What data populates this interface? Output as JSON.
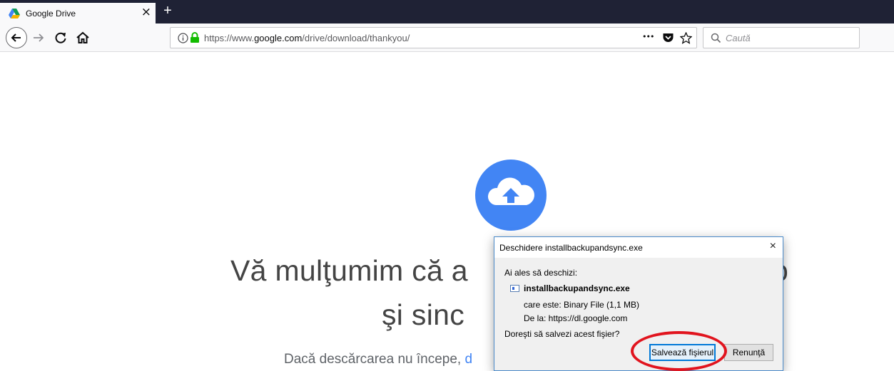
{
  "browser": {
    "tab": {
      "title": "Google Drive",
      "close_glyph": "×"
    },
    "new_tab_glyph": "+",
    "url": {
      "prefix": "https://www.",
      "host": "google.com",
      "path": "/drive/download/thankyou/"
    },
    "page_actions_glyph": "•••",
    "search": {
      "placeholder": "Caută"
    }
  },
  "page": {
    "headline_line1": "Vă mulţumim că a",
    "headline_line1_tail": "o",
    "headline_line2": "şi sinc",
    "subline_text": "Dacă descărcarea nu începe, ",
    "subline_link": "d",
    "colors": {
      "cloud_blue": "#4285f4",
      "link": "#4285f4"
    }
  },
  "dialog": {
    "title": "Deschidere installbackupandsync.exe",
    "close_glyph": "×",
    "chose_to_open": "Ai ales să deschizi:",
    "file_name": "installbackupandsync.exe",
    "type_line": "care este:  Binary File (1,1 MB)",
    "from_line": "De la:  https://dl.google.com",
    "question": "Doreşti să salvezi acest fişier?",
    "save_label": "Salvează fişierul",
    "cancel_label": "Renunţă"
  },
  "annotation": {
    "ring_color": "#e1141e"
  }
}
